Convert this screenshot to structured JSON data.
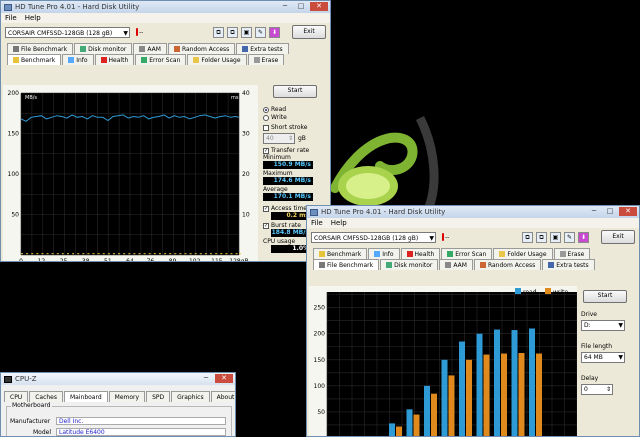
{
  "win1": {
    "title": "HD Tune Pro 4.01 - Hard Disk Utility",
    "menu": [
      "File",
      "Help"
    ],
    "drive": "CORSAIR CMFSSD-128GB   (128 gB)",
    "temp": "-- ",
    "exit": "Exit",
    "tabs_top": [
      "File Benchmark",
      "Disk monitor",
      "AAM",
      "Random Access",
      "Extra tests"
    ],
    "tabs_bottom": [
      "Benchmark",
      "Info",
      "Health",
      "Error Scan",
      "Folder Usage",
      "Erase"
    ],
    "y_unit": "MB/s",
    "y2_unit": "ms",
    "y_ticks": [
      "200",
      "150",
      "100",
      "50"
    ],
    "y2_ticks": [
      "40",
      "30",
      "20",
      "10"
    ],
    "x_ticks": [
      "0",
      "12",
      "25",
      "38",
      "51",
      "64",
      "76",
      "89",
      "102",
      "115",
      "128gB"
    ],
    "start": "Start",
    "read": "Read",
    "write": "Write",
    "short_stroke": "Short stroke",
    "stroke_val": "40",
    "stroke_unit": "gB",
    "transfer_rate": "Transfer rate",
    "minimum_label": "Minimum",
    "minimum_val": "150.9 MB/s",
    "maximum_label": "Maximum",
    "maximum_val": "174.6 MB/s",
    "average_label": "Average",
    "average_val": "170.1 MB/s",
    "access_time_label": "Access time",
    "access_time_val": "0.2 ms",
    "burst_rate_label": "Burst rate",
    "burst_rate_val": "184.8 MB/s",
    "cpu_usage_label": "CPU usage",
    "cpu_usage_val": "1.0%"
  },
  "win2": {
    "title": "HD Tune Pro 4.01 - Hard Disk Utility",
    "menu": [
      "File",
      "Help"
    ],
    "drive": "CORSAIR CMFSSD-128GB   (128 gB)",
    "temp": "-- ",
    "exit": "Exit",
    "tabs_top": [
      "Benchmark",
      "Info",
      "Health",
      "Error Scan",
      "Folder Usage",
      "Erase"
    ],
    "tabs_bottom": [
      "File Benchmark",
      "Disk monitor",
      "AAM",
      "Random Access",
      "Extra tests"
    ],
    "y_unit": "MB/s",
    "legend_read": "read",
    "legend_write": "write",
    "y_ticks": [
      "250",
      "200",
      "150",
      "100",
      "50"
    ],
    "start": "Start",
    "drive_label": "Drive",
    "drive_val": "D:",
    "file_length_label": "File length",
    "file_length_val": "64 MB",
    "delay_label": "Delay",
    "delay_val": "0"
  },
  "cpuz": {
    "title": "CPU-Z",
    "tabs": [
      "CPU",
      "Caches",
      "Mainboard",
      "Memory",
      "SPD",
      "Graphics",
      "About"
    ],
    "group": "Motherboard",
    "manufacturer_label": "Manufacturer",
    "manufacturer_val": "Dell Inc.",
    "model_label": "Model",
    "model_val": "Latitude E6400"
  },
  "chart_data": [
    {
      "type": "line",
      "title": "",
      "xlabel": "gB",
      "ylabel": "MB/s",
      "y2label": "ms",
      "ylim": [
        0,
        200
      ],
      "y2lim": [
        0,
        40
      ],
      "x": [
        0,
        3,
        6,
        9,
        12,
        15,
        18,
        21,
        24,
        27,
        30,
        33,
        36,
        39,
        42,
        45,
        48,
        51,
        54,
        57,
        60,
        63,
        66,
        69,
        72,
        75,
        78,
        81,
        84,
        87,
        90,
        93,
        96,
        99,
        102,
        105,
        108,
        111,
        114,
        117,
        120,
        123,
        126,
        128
      ],
      "series": [
        {
          "name": "Read",
          "color": "#2e9bd6",
          "values": [
            168,
            165,
            170,
            171,
            172,
            168,
            170,
            172,
            171,
            169,
            173,
            170,
            171,
            168,
            172,
            170,
            170,
            166,
            171,
            172,
            173,
            169,
            171,
            170,
            172,
            168,
            170,
            171,
            173,
            169,
            172,
            170,
            171,
            168,
            170,
            172,
            173,
            171,
            169,
            171,
            172,
            170,
            171,
            170
          ]
        },
        {
          "name": "Access time",
          "color": "#e8c640",
          "values": [
            0.2,
            0.2,
            0.2,
            0.2,
            0.2,
            0.2,
            0.2,
            0.2,
            0.2,
            0.2,
            0.2,
            0.2,
            0.2,
            0.2,
            0.2,
            0.2,
            0.2,
            0.2,
            0.2,
            0.2,
            0.2,
            0.2,
            0.2,
            0.2,
            0.2,
            0.2,
            0.2,
            0.2,
            0.2,
            0.2,
            0.2,
            0.2,
            0.2,
            0.2,
            0.2,
            0.2,
            0.2,
            0.2,
            0.2,
            0.2,
            0.2,
            0.2,
            0.2,
            0.2
          ]
        }
      ]
    },
    {
      "type": "bar",
      "title": "",
      "ylabel": "MB/s",
      "ylim": [
        0,
        280
      ],
      "series": [
        {
          "name": "read",
          "color": "#2e9bd6",
          "values": [
            28,
            55,
            100,
            150,
            185,
            200,
            208,
            207,
            210
          ]
        },
        {
          "name": "write",
          "color": "#e08a1e",
          "values": [
            22,
            45,
            85,
            120,
            150,
            160,
            162,
            163,
            162
          ]
        }
      ]
    }
  ]
}
